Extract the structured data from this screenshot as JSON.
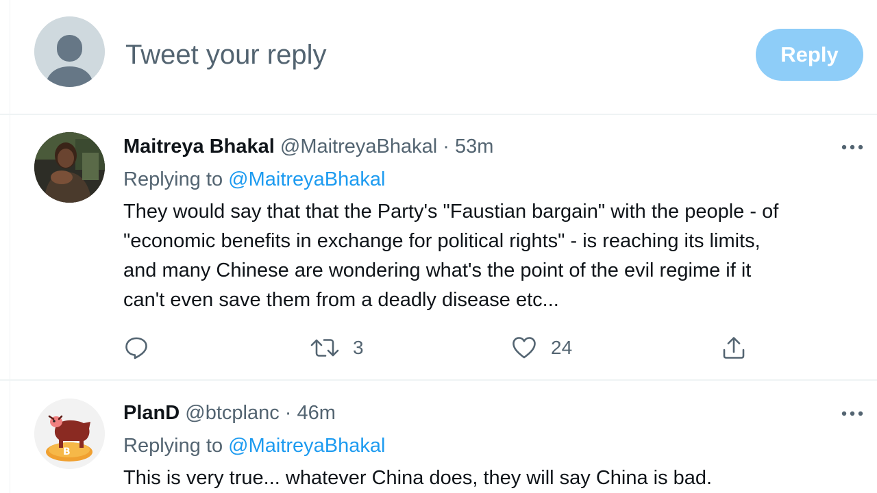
{
  "compose": {
    "placeholder": "Tweet your reply",
    "reply_button_label": "Reply",
    "avatar_icon": "default-user-icon"
  },
  "tweets": [
    {
      "display_name": "Maitreya Bhakal",
      "handle": "@MaitreyaBhakal",
      "separator": "·",
      "time": "53m",
      "replying_prefix": "Replying to",
      "replying_to": "@MaitreyaBhakal",
      "lines": [
        "They would say that that the Party's \"Faustian bargain\" with the people - of",
        "\"economic benefits in exchange for political rights\" - is reaching its limits,",
        "and many Chinese are wondering what's the point of the evil regime if it",
        "can't even save them from a deadly disease etc..."
      ],
      "actions": {
        "reply_count": "",
        "retweet_count": "3",
        "like_count": "24"
      }
    },
    {
      "display_name": "PlanD",
      "handle": "@btcplanc",
      "separator": "·",
      "time": "46m",
      "replying_prefix": "Replying to",
      "replying_to": "@MaitreyaBhakal",
      "lines": [
        "This is very true... whatever China does, they will say China is bad."
      ]
    }
  ],
  "colors": {
    "accent": "#1d9bf0",
    "reply_button_disabled": "#8ecdf8",
    "secondary_text": "#536471",
    "divider": "#eff3f4"
  }
}
